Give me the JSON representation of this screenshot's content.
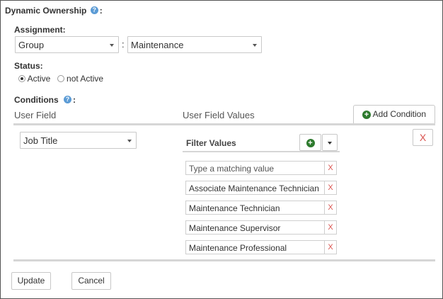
{
  "section": {
    "title": "Dynamic Ownership",
    "title_suffix": ":",
    "help_icon": "question-circle-icon"
  },
  "assignment": {
    "label": "Assignment:",
    "type_value": "Group",
    "separator": ":",
    "target_value": "Maintenance"
  },
  "status": {
    "label": "Status:",
    "options": [
      {
        "label": "Active",
        "selected": true
      },
      {
        "label": "not Active",
        "selected": false
      }
    ]
  },
  "conditions": {
    "label": "Conditions",
    "suffix": ":",
    "user_field_header": "User Field",
    "user_field_values_header": "User Field Values",
    "add_condition_label": "Add Condition",
    "user_field_value": "Job Title",
    "filter_values_label": "Filter Values",
    "remove_condition_label": "X",
    "value_placeholder": "Type a matching value",
    "value_delete_label": "X",
    "values": [
      "Associate Maintenance Technician",
      "Maintenance Technician",
      "Maintenance Supervisor",
      "Maintenance Professional"
    ]
  },
  "actions": {
    "update_label": "Update",
    "cancel_label": "Cancel"
  },
  "colors": {
    "add_green": "#2d7a2d",
    "delete_red": "#d9534f",
    "help_blue": "#5b9bd5"
  }
}
